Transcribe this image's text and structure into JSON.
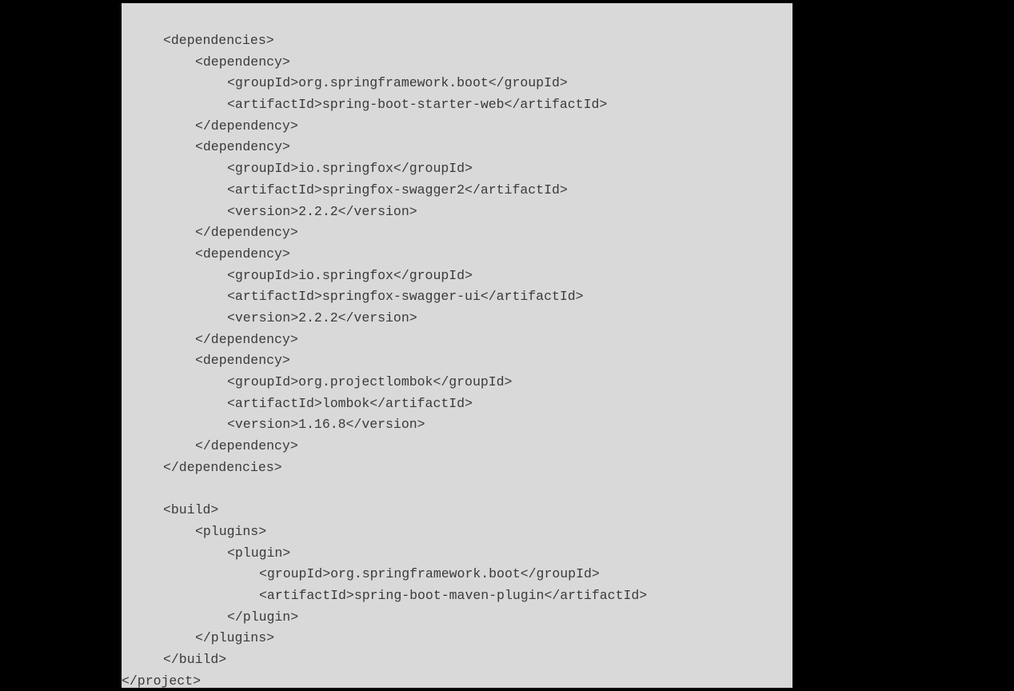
{
  "code": {
    "lines": [
      {
        "indent": 1,
        "text": "<dependencies>"
      },
      {
        "indent": 2,
        "text": "<dependency>"
      },
      {
        "indent": 3,
        "text": "<groupId>org.springframework.boot</groupId>"
      },
      {
        "indent": 3,
        "text": "<artifactId>spring-boot-starter-web</artifactId>"
      },
      {
        "indent": 2,
        "text": "</dependency>"
      },
      {
        "indent": 2,
        "text": "<dependency>"
      },
      {
        "indent": 3,
        "text": "<groupId>io.springfox</groupId>"
      },
      {
        "indent": 3,
        "text": "<artifactId>springfox-swagger2</artifactId>"
      },
      {
        "indent": 3,
        "text": "<version>2.2.2</version>"
      },
      {
        "indent": 2,
        "text": "</dependency>"
      },
      {
        "indent": 2,
        "text": "<dependency>"
      },
      {
        "indent": 3,
        "text": "<groupId>io.springfox</groupId>"
      },
      {
        "indent": 3,
        "text": "<artifactId>springfox-swagger-ui</artifactId>"
      },
      {
        "indent": 3,
        "text": "<version>2.2.2</version>"
      },
      {
        "indent": 2,
        "text": "</dependency>"
      },
      {
        "indent": 2,
        "text": "<dependency>"
      },
      {
        "indent": 3,
        "text": "<groupId>org.projectlombok</groupId>"
      },
      {
        "indent": 3,
        "text": "<artifactId>lombok</artifactId>"
      },
      {
        "indent": 3,
        "text": "<version>1.16.8</version>"
      },
      {
        "indent": 2,
        "text": "</dependency>"
      },
      {
        "indent": 1,
        "text": "</dependencies>"
      },
      {
        "indent": 0,
        "text": ""
      },
      {
        "indent": 1,
        "text": "<build>"
      },
      {
        "indent": 2,
        "text": "<plugins>"
      },
      {
        "indent": 3,
        "text": "<plugin>"
      },
      {
        "indent": 4,
        "text": "<groupId>org.springframework.boot</groupId>"
      },
      {
        "indent": 4,
        "text": "<artifactId>spring-boot-maven-plugin</artifactId>"
      },
      {
        "indent": 3,
        "text": "</plugin>"
      },
      {
        "indent": 2,
        "text": "</plugins>"
      },
      {
        "indent": 1,
        "text": "</build>"
      },
      {
        "indent": 0,
        "text": "</project>"
      }
    ]
  },
  "colors": {
    "background": "#000000",
    "panel": "#d9d9d9",
    "text": "#3a3a3a"
  }
}
